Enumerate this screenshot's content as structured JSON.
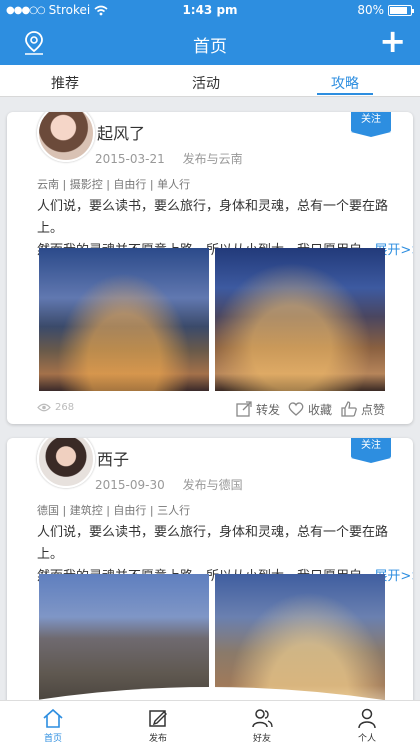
{
  "status_bar": {
    "carrier": "Strokei",
    "time": "1:43 pm",
    "battery": "80%"
  },
  "nav": {
    "title": "首页",
    "location_icon": "location-pin-icon",
    "add_icon": "plus-icon"
  },
  "tabs": [
    {
      "label": "推荐"
    },
    {
      "label": "活动"
    },
    {
      "label": "攻略"
    }
  ],
  "active_tab": "攻略",
  "posts": [
    {
      "name": "起风了",
      "date": "2015-03-21",
      "location": "发布与云南",
      "follow": "关注",
      "tags": "云南 | 摄影控 | 自由行 | 单人行",
      "content_line1": "人们说，要么读书，要么旅行，身体和灵魂，总有一个要在路上。",
      "content_line2": "然而我的灵魂并不愿意上路，所以从小到大，我只愿用自...",
      "more": "展开>>",
      "views": "268",
      "repost": "转发",
      "favorite": "收藏",
      "like": "点赞"
    },
    {
      "name": "西子",
      "date": "2015-09-30",
      "location": "发布与德国",
      "follow": "关注",
      "tags": "德国 | 建筑控 | 自由行 | 三人行",
      "content_line1": "人们说，要么读书，要么旅行，身体和灵魂，总有一个要在路上。",
      "content_line2": "然而我的灵魂并不愿意上路，所以从小到大，我只愿用自...",
      "more": "展开>>"
    }
  ],
  "tabbar": [
    {
      "label": "首页",
      "icon": "home-icon"
    },
    {
      "label": "发布",
      "icon": "edit-icon"
    },
    {
      "label": "好友",
      "icon": "friends-icon"
    },
    {
      "label": "个人",
      "icon": "profile-icon"
    }
  ],
  "colors": {
    "accent": "#2d8ee0",
    "background": "#e9ebee"
  }
}
